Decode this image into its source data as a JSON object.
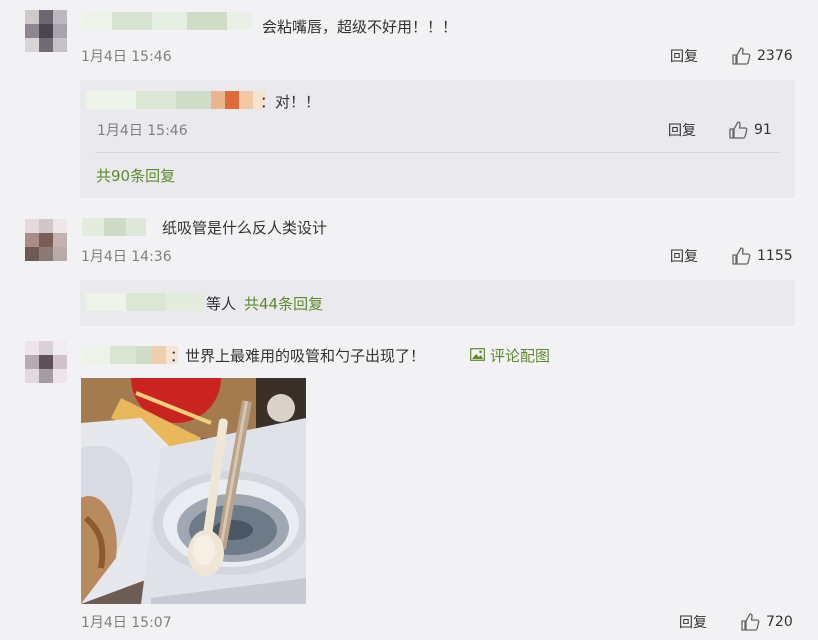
{
  "comments": [
    {
      "text": "会粘嘴唇，超级不好用！！！",
      "time": "1月4日 15:46",
      "reply_label": "回复",
      "likes": "2376",
      "sub_reply": {
        "text": "：对！！",
        "time": "1月4日 15:46",
        "reply_label": "回复",
        "likes": "91",
        "more_label": "共90条回复"
      }
    },
    {
      "text": "纸吸管是什么反人类设计",
      "time": "1月4日 14:36",
      "reply_label": "回复",
      "likes": "1155",
      "sub_reply": {
        "suffix": "等人",
        "more_label": "共44条回复"
      }
    },
    {
      "text": "：世界上最难用的吸管和勺子出现了！",
      "image_link": "评论配图",
      "time": "1月4日 15:07",
      "reply_label": "回复",
      "likes": "720"
    }
  ],
  "colors": {
    "background": "#f2f2f5",
    "reply_box": "#e9e9ee",
    "link_green": "#5f8a2c",
    "timestamp": "#808080"
  }
}
